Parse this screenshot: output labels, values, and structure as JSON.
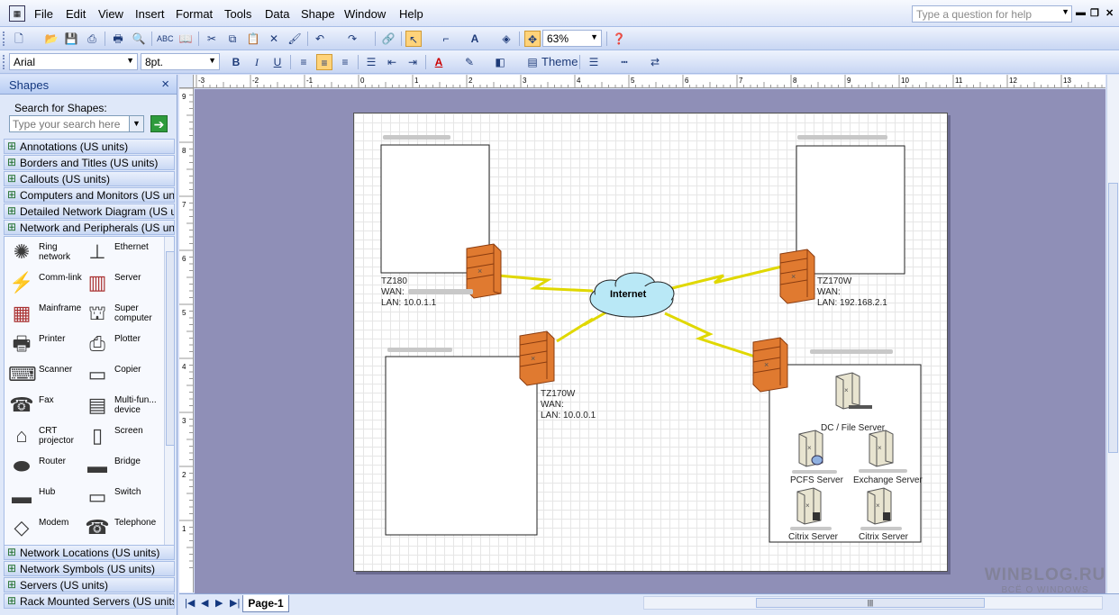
{
  "menu": [
    "File",
    "Edit",
    "View",
    "Insert",
    "Format",
    "Tools",
    "Data",
    "Shape",
    "Window",
    "Help"
  ],
  "help_placeholder": "Type a question for help",
  "toolbar": {
    "zoom": "63%",
    "font": "Arial",
    "font_size": "8pt.",
    "theme_label": "Theme"
  },
  "shapes_pane": {
    "title": "Shapes",
    "search_label": "Search for Shapes:",
    "search_placeholder": "Type your search here",
    "stencils_top": [
      "Annotations (US units)",
      "Borders and Titles (US units)",
      "Callouts (US units)",
      "Computers and Monitors (US units)",
      "Detailed Network Diagram (US un...",
      "Network and Peripherals (US units)"
    ],
    "shapes": [
      {
        "label": "Ring network",
        "icon": "ring-network-icon"
      },
      {
        "label": "Ethernet",
        "icon": "ethernet-icon"
      },
      {
        "label": "Comm-link",
        "icon": "comm-link-icon"
      },
      {
        "label": "Server",
        "icon": "server-icon"
      },
      {
        "label": "Mainframe",
        "icon": "mainframe-icon"
      },
      {
        "label": "Super computer",
        "icon": "super-computer-icon"
      },
      {
        "label": "Printer",
        "icon": "printer-icon"
      },
      {
        "label": "Plotter",
        "icon": "plotter-icon"
      },
      {
        "label": "Scanner",
        "icon": "scanner-icon"
      },
      {
        "label": "Copier",
        "icon": "copier-icon"
      },
      {
        "label": "Fax",
        "icon": "fax-icon"
      },
      {
        "label": "Multi-fun... device",
        "icon": "multifunction-icon"
      },
      {
        "label": "CRT projector",
        "icon": "projector-icon"
      },
      {
        "label": "Screen",
        "icon": "screen-icon"
      },
      {
        "label": "Router",
        "icon": "router-icon"
      },
      {
        "label": "Bridge",
        "icon": "bridge-icon"
      },
      {
        "label": "Hub",
        "icon": "hub-icon"
      },
      {
        "label": "Switch",
        "icon": "switch-icon"
      },
      {
        "label": "Modem",
        "icon": "modem-icon"
      },
      {
        "label": "Telephone",
        "icon": "telephone-icon"
      }
    ],
    "stencils_bottom": [
      "Network Locations (US units)",
      "Network Symbols (US units)",
      "Servers (US units)",
      "Rack Mounted Servers (US units)"
    ]
  },
  "ruler_top": [
    "-3",
    "-2",
    "-1",
    "0",
    "1",
    "2",
    "3",
    "4",
    "5",
    "6",
    "7",
    "8",
    "9",
    "10",
    "11",
    "12",
    "13"
  ],
  "ruler_left": [
    "9",
    "8",
    "7",
    "6",
    "5",
    "4",
    "3",
    "2",
    "1"
  ],
  "diagram": {
    "cloud_label": "Internet",
    "site_tz180": {
      "name": "TZ180",
      "wan": "WAN:",
      "lan": "LAN: 10.0.1.1"
    },
    "site_tz170_right": {
      "name": "TZ170W",
      "wan": "WAN:",
      "lan": "LAN: 192.168.2.1"
    },
    "site_tz170_bottom": {
      "name": "TZ170W",
      "wan": "WAN:",
      "lan": "LAN: 10.0.0.1"
    },
    "servers": [
      "DC / File Server",
      "PCFS Server",
      "Exchange Server",
      "Citrix Server",
      "Citrix Server"
    ]
  },
  "page_tab": "Page-1",
  "watermark": {
    "line1": "WINBLOG.RU",
    "line2": "ВСЁ О WINDOWS"
  }
}
